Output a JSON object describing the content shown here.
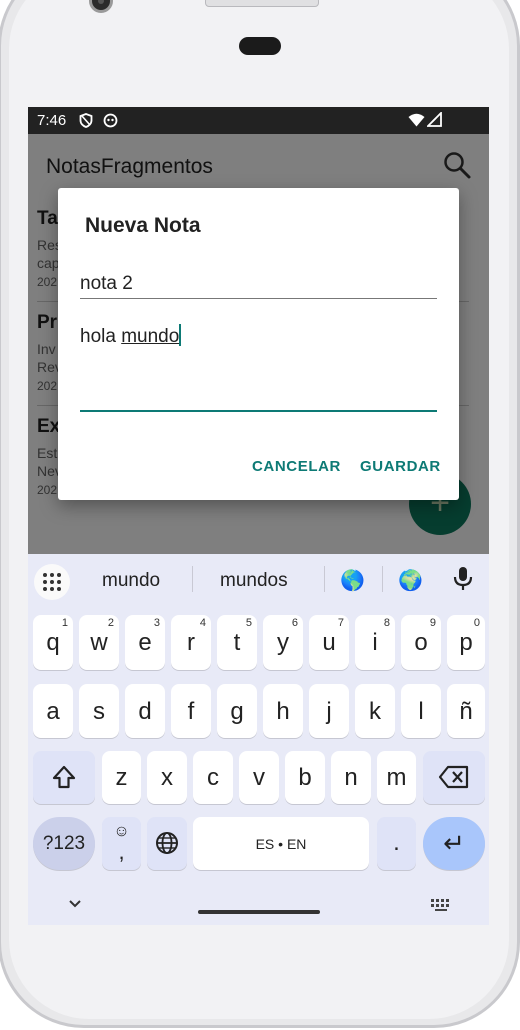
{
  "status_bar": {
    "time": "7:46"
  },
  "app_bar": {
    "title": "NotasFragmentos"
  },
  "notes": [
    {
      "title": "Ta",
      "line1": "Res",
      "line2": "cap",
      "date": "202"
    },
    {
      "title": "Pr",
      "line1": "Inv",
      "line2": "Rev",
      "date": "202"
    },
    {
      "title": "Ex",
      "line1": "Est",
      "line2": "Nev",
      "date": "202"
    }
  ],
  "fab": {
    "label": "+"
  },
  "dialog": {
    "title": "Nueva Nota",
    "title_field_value": "nota 2",
    "body_text_start": "hola ",
    "body_text_underlined": "mundo",
    "cancel_label": "CANCELAR",
    "save_label": "GUARDAR"
  },
  "keyboard": {
    "suggestions": [
      "mundo",
      "mundos"
    ],
    "emojis": [
      "🌎",
      "🌍"
    ],
    "row1": [
      {
        "k": "q",
        "s": "1"
      },
      {
        "k": "w",
        "s": "2"
      },
      {
        "k": "e",
        "s": "3"
      },
      {
        "k": "r",
        "s": "4"
      },
      {
        "k": "t",
        "s": "5"
      },
      {
        "k": "y",
        "s": "6"
      },
      {
        "k": "u",
        "s": "7"
      },
      {
        "k": "i",
        "s": "8"
      },
      {
        "k": "o",
        "s": "9"
      },
      {
        "k": "p",
        "s": "0"
      }
    ],
    "row2": [
      "a",
      "s",
      "d",
      "f",
      "g",
      "h",
      "j",
      "k",
      "l",
      "ñ"
    ],
    "row3": [
      "z",
      "x",
      "c",
      "v",
      "b",
      "n",
      "m"
    ],
    "symbols_label": "?123",
    "emoji_key_label": "☺",
    "comma_label": ",",
    "space_label": "ES • EN",
    "period_label": ".",
    "enter_label": "↵"
  },
  "colors": {
    "accent": "#0d7a75",
    "fab": "#0d7a5f"
  }
}
